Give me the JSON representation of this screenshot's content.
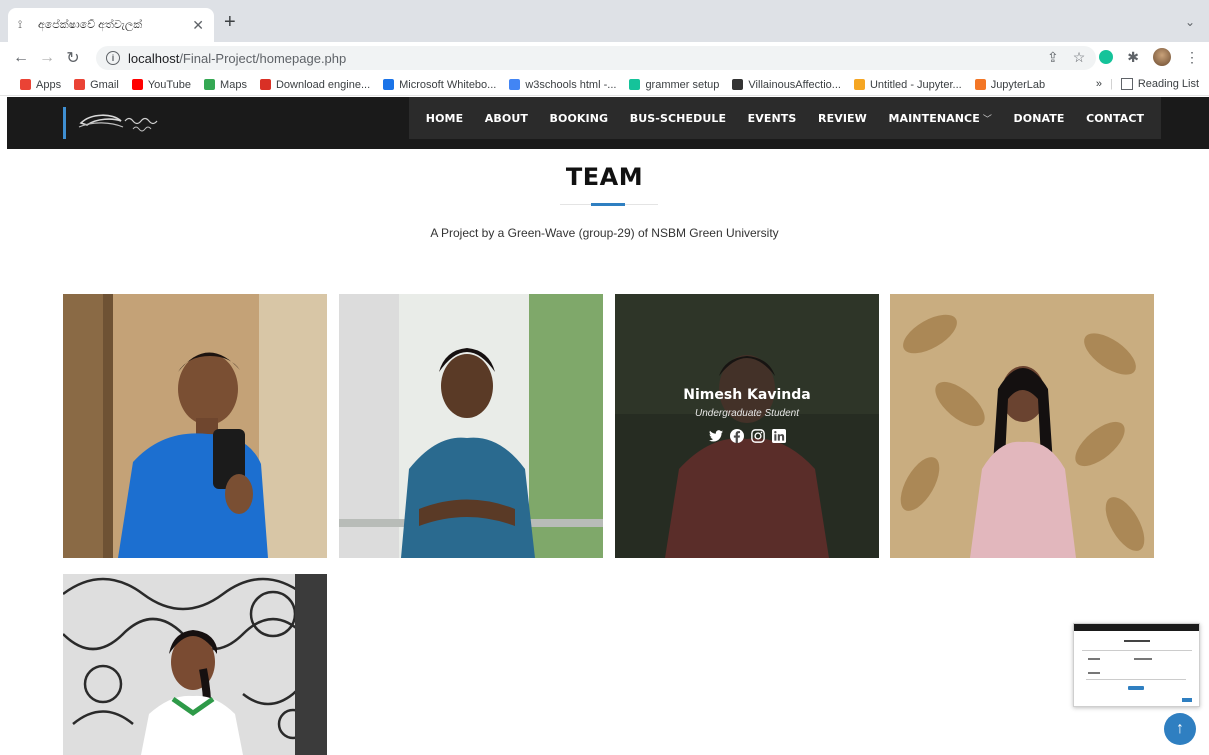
{
  "browser": {
    "tab_title": "අපේක්ෂාවේ අත්වැලක්",
    "url_host": "localhost",
    "url_path": "/Final-Project/homepage.php",
    "bookmarks": [
      {
        "label": "Apps",
        "icon": "apps-grid-icon",
        "color": "#ea4335"
      },
      {
        "label": "Gmail",
        "icon": "gmail-icon",
        "color": "#ea4335"
      },
      {
        "label": "YouTube",
        "icon": "youtube-icon",
        "color": "#ff0000"
      },
      {
        "label": "Maps",
        "icon": "maps-pin-icon",
        "color": "#34a853"
      },
      {
        "label": "Download engine...",
        "icon": "x-icon",
        "color": "#d93025"
      },
      {
        "label": "Microsoft Whitebo...",
        "icon": "whiteboard-icon",
        "color": "#1a73e8"
      },
      {
        "label": "w3schools html -...",
        "icon": "google-icon",
        "color": "#4285f4"
      },
      {
        "label": "grammer setup",
        "icon": "grammarly-icon",
        "color": "#15c39a"
      },
      {
        "label": "VillainousAffectio...",
        "icon": "app-icon",
        "color": "#333333"
      },
      {
        "label": "Untitled - Jupyter...",
        "icon": "jupyter-file-icon",
        "color": "#f5a623"
      },
      {
        "label": "JupyterLab",
        "icon": "jupyter-icon",
        "color": "#f37626"
      }
    ],
    "more_bookmarks": "»",
    "reading_list": "Reading List"
  },
  "site": {
    "menu": [
      "HOME",
      "ABOUT",
      "BOOKING",
      "BUS-SCHEDULE",
      "EVENTS",
      "REVIEW",
      "MAINTENANCE",
      "DONATE",
      "CONTACT"
    ]
  },
  "team": {
    "title": "TEAM",
    "subtitle": "A Project by a Green-Wave (group-29) of NSBM Green University",
    "featured": {
      "name": "Nimesh Kavinda",
      "role": "Undergraduate Student",
      "socials": [
        "twitter-icon",
        "facebook-icon",
        "instagram-icon",
        "linkedin-icon"
      ]
    }
  },
  "colors": {
    "accent": "#2f7fc1",
    "header_bg": "#1a1a1a"
  }
}
